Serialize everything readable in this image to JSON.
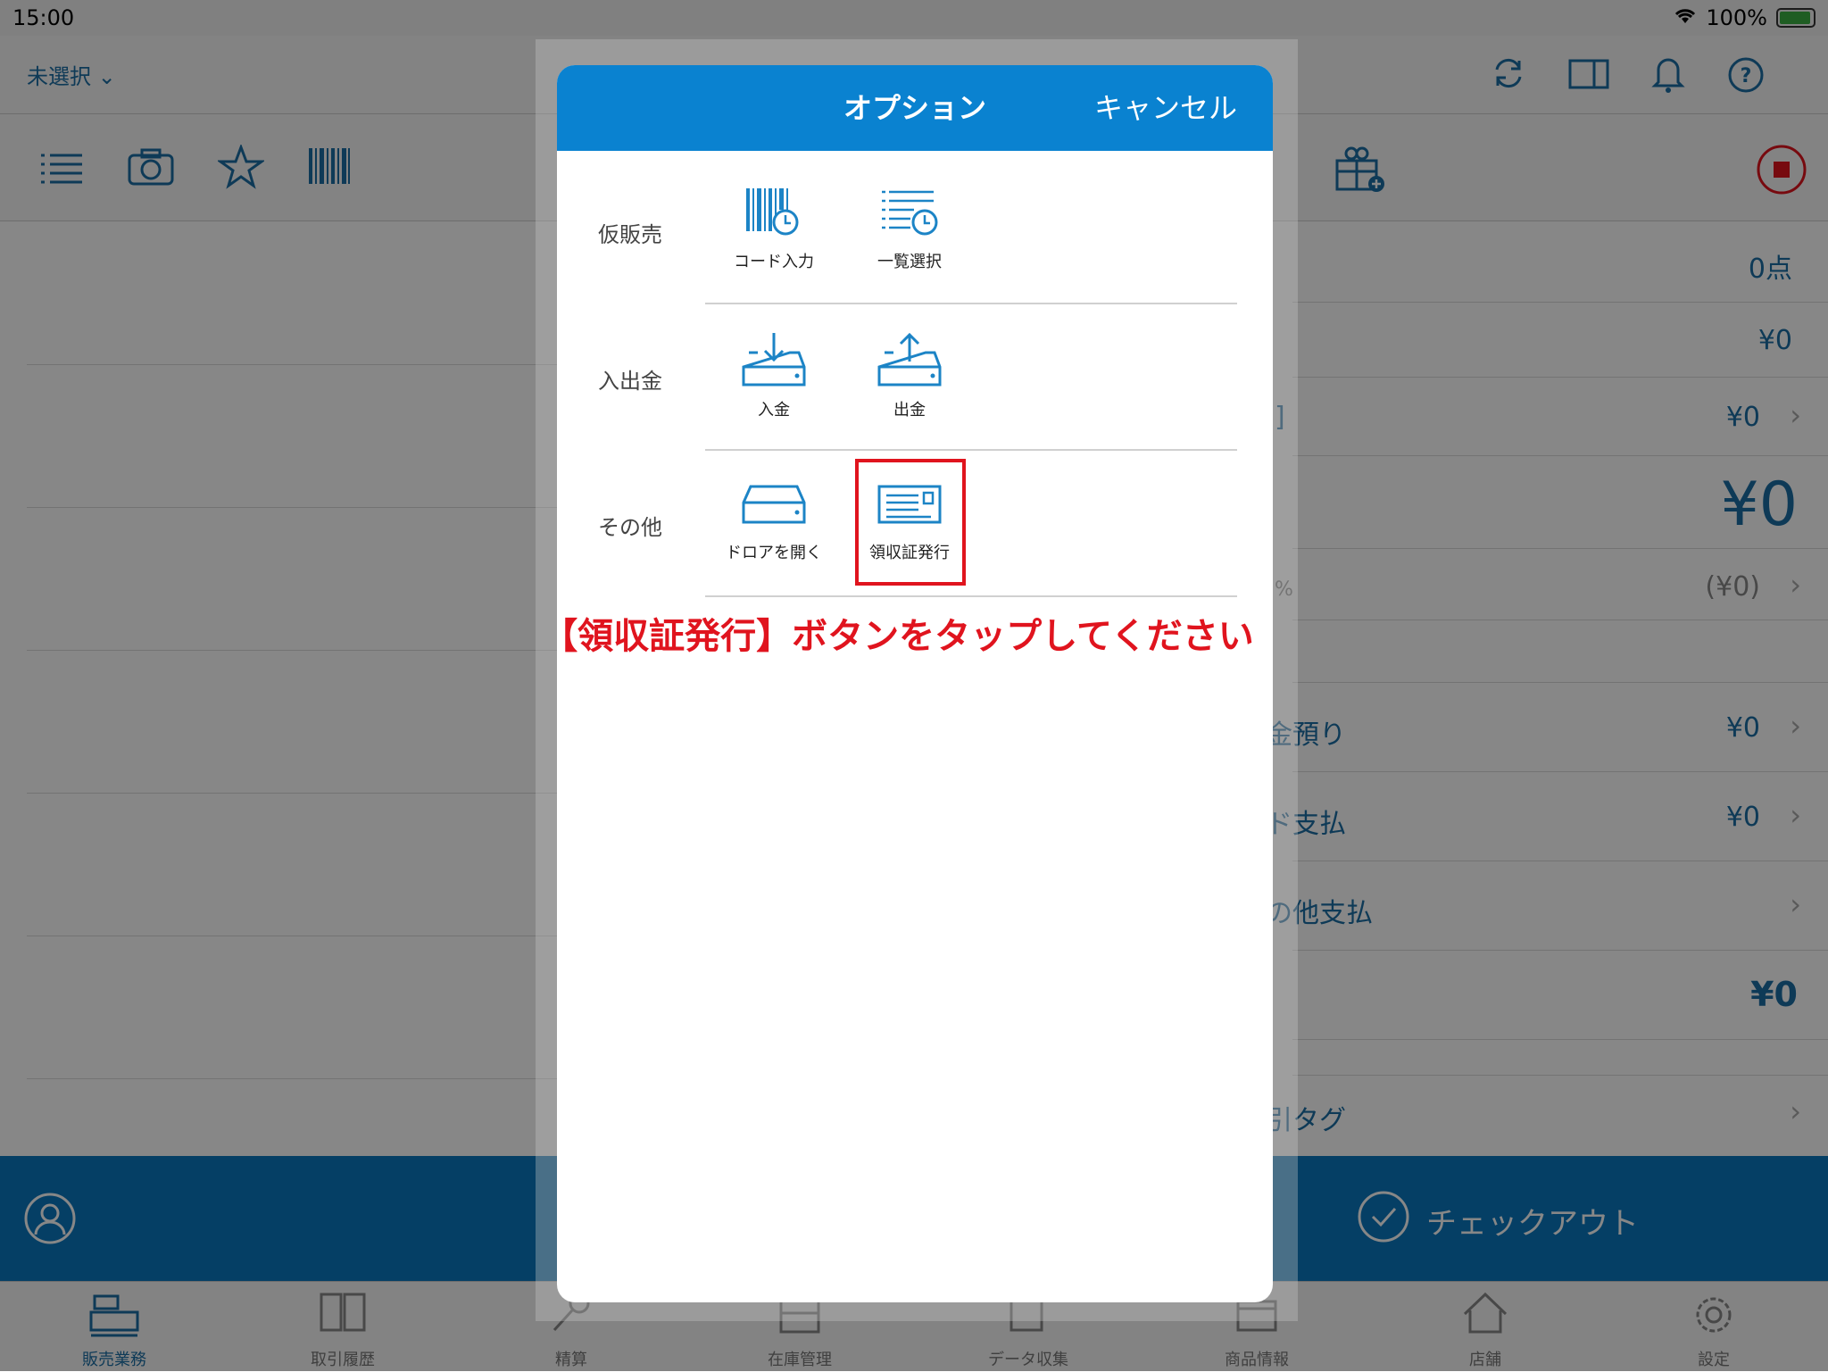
{
  "status": {
    "time": "15:00",
    "battery": "100%"
  },
  "nav": {
    "store_select": "未選択"
  },
  "right_panel": {
    "count": "0点",
    "subtotal": "¥0",
    "discount": "¥0",
    "total": "¥0",
    "tax": "(¥0)",
    "cash_label": "金預り",
    "cash_value": "¥0",
    "card_label": "ド支払",
    "card_value": "¥0",
    "other_label": "の他支払",
    "change_value": "¥0",
    "tag_label": "引タグ",
    "percent": "%",
    "partial_char": "]"
  },
  "bottom": {
    "checkout": "チェックアウト"
  },
  "tabs": [
    {
      "label": "販売業務",
      "icon": "register-icon"
    },
    {
      "label": "取引履歴",
      "icon": "book-icon"
    },
    {
      "label": "精算",
      "icon": "key-icon"
    },
    {
      "label": "在庫管理",
      "icon": "cabinet-icon"
    },
    {
      "label": "データ収集",
      "icon": "puzzle-icon"
    },
    {
      "label": "商品情報",
      "icon": "box-icon"
    },
    {
      "label": "店舗",
      "icon": "home-icon"
    },
    {
      "label": "設定",
      "icon": "gear-icon"
    }
  ],
  "modal": {
    "title": "オプション",
    "cancel": "キャンセル",
    "sections": [
      {
        "label": "仮販売",
        "options": [
          "コード入力",
          "一覧選択"
        ]
      },
      {
        "label": "入出金",
        "options": [
          "入金",
          "出金"
        ]
      },
      {
        "label": "その他",
        "options": [
          "ドロアを開く",
          "領収証発行"
        ]
      }
    ]
  },
  "instruction": "【領収証発行】ボタンをタップしてください",
  "colors": {
    "accent": "#0a82d0",
    "highlight": "#e0141e"
  }
}
